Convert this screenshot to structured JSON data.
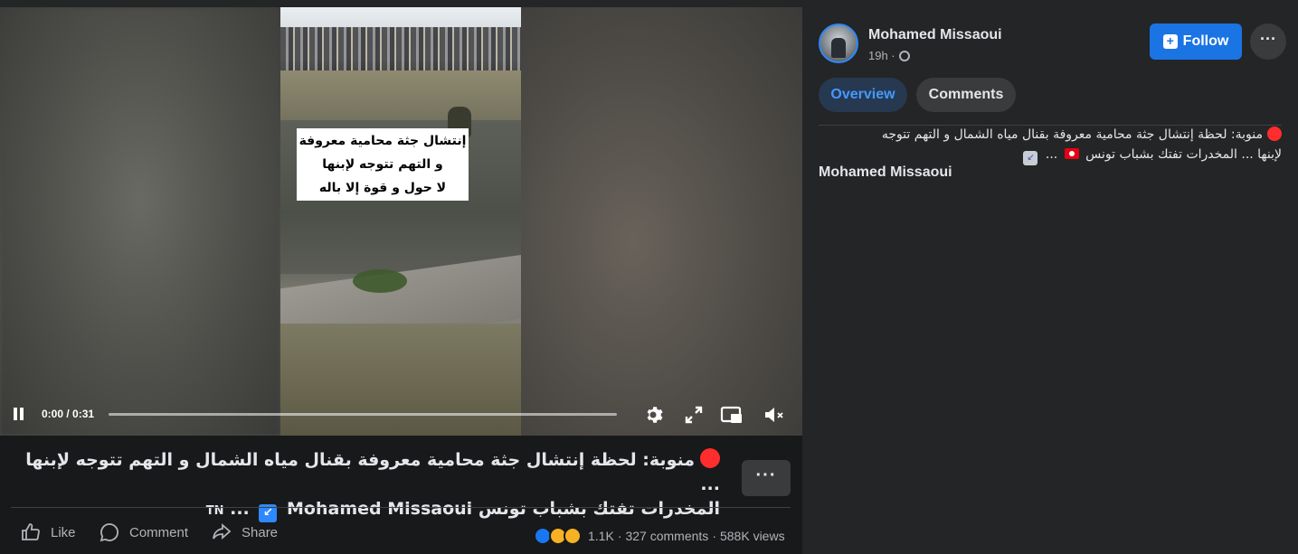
{
  "video": {
    "overlay_caption_lines": [
      "إنتشال جثة محامية معروفة",
      "و التهم تتوجه لإبنها",
      "لا حول و قوة إلا باله"
    ],
    "time_display": "0:00 / 0:31",
    "progress_fraction": 0.0
  },
  "post": {
    "title_line1": "منوبة: لحظة إنتشال جثة محامية معروفة بقنال مياه الشمال و التهم تتوجه لإبنها ...",
    "title_line2_text": "المخدرات تفتك بشباب تونس",
    "title_line2_author": "Mohamed Missaoui",
    "title_line2_ellipsis": "...",
    "title_flag_code": "TN",
    "more_label": "···",
    "actions": {
      "like": "Like",
      "comment": "Comment",
      "share": "Share"
    },
    "stats": {
      "reactions": "1.1K",
      "comments": "327 comments",
      "views": "588K views",
      "separator": "·"
    }
  },
  "sidebar": {
    "author": "Mohamed Missaoui",
    "time": "19h ·",
    "follow_label": "Follow",
    "more_label": "···",
    "tabs": [
      {
        "label": "Overview"
      },
      {
        "label": "Comments"
      }
    ],
    "description_line1": "منوبة: لحظة إنتشال جثة محامية معروفة بقنال مياه الشمال و التهم تتوجه",
    "description_line2": "لإبنها ... المخدرات تفتك بشباب تونس",
    "description_ellipsis": "...",
    "description_author": "Mohamed Missaoui"
  },
  "colors": {
    "accent_blue": "#1b74e4",
    "tab_active_bg": "#263951",
    "tab_active_text": "#4599ff",
    "live_red": "#ff2d2d"
  },
  "icons": [
    "pause-icon",
    "gear-icon",
    "expand-icon",
    "picture-in-picture-icon",
    "mute-icon",
    "like-icon",
    "comment-icon",
    "share-icon",
    "globe-icon",
    "plus-icon"
  ]
}
